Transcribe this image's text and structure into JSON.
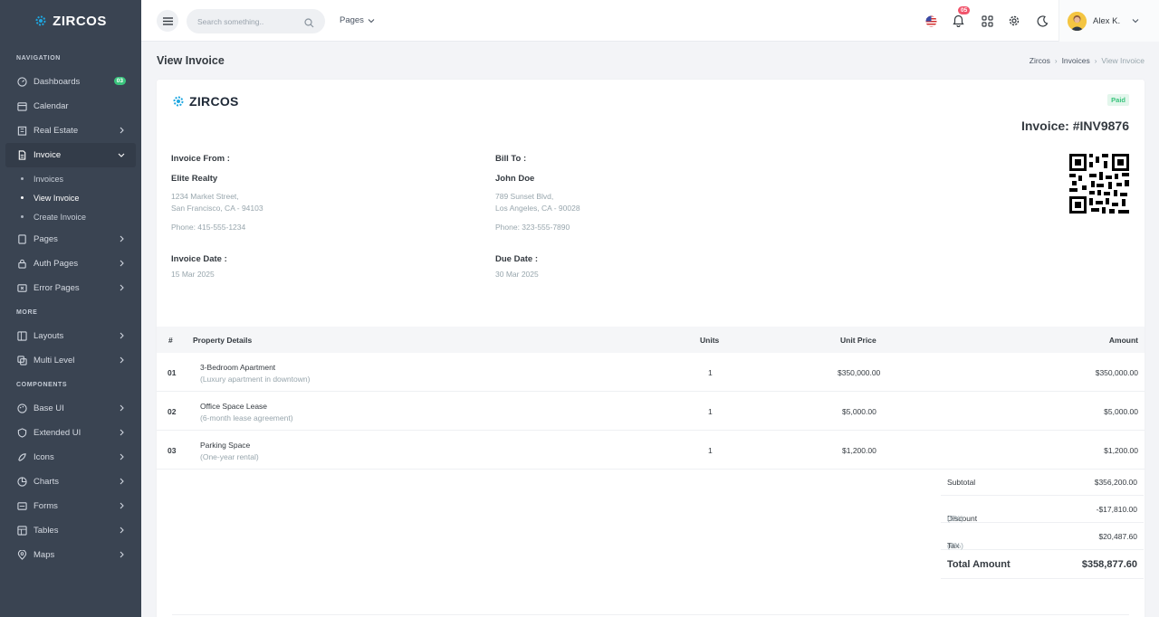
{
  "brand": {
    "name": "ZIRCOS"
  },
  "sidebar": {
    "sections": {
      "navigation": "NAVIGATION",
      "more": "MORE",
      "components": "COMPONENTS"
    },
    "items": {
      "dashboards": "Dashboards",
      "dashboards_badge": "03",
      "calendar": "Calendar",
      "real_estate": "Real Estate",
      "invoice": "Invoice",
      "invoices": "Invoices",
      "view_invoice": "View Invoice",
      "create_invoice": "Create Invoice",
      "pages": "Pages",
      "auth_pages": "Auth Pages",
      "error_pages": "Error Pages",
      "layouts": "Layouts",
      "multi_level": "Multi Level",
      "base_ui": "Base UI",
      "extended_ui": "Extended UI",
      "icons": "Icons",
      "charts": "Charts",
      "forms": "Forms",
      "tables": "Tables",
      "maps": "Maps"
    }
  },
  "topbar": {
    "search_placeholder": "Search something..",
    "pages_label": "Pages",
    "notification_count": "05",
    "user_name": "Alex K."
  },
  "page": {
    "title": "View Invoice",
    "breadcrumb": [
      "Zircos",
      "Invoices",
      "View Invoice"
    ]
  },
  "invoice": {
    "status": "Paid",
    "number": "Invoice: #INV9876",
    "from_label": "Invoice From :",
    "from_name": "Elite Realty",
    "from_address1": "1234 Market Street,",
    "from_address2": "San Francisco, CA - 94103",
    "from_phone": "Phone: 415-555-1234",
    "to_label": "Bill To :",
    "to_name": "John Doe",
    "to_address1": "789 Sunset Blvd,",
    "to_address2": "Los Angeles, CA - 90028",
    "to_phone": "Phone: 323-555-7890",
    "date_label": "Invoice Date :",
    "date_value": "15 Mar 2025",
    "due_label": "Due Date :",
    "due_value": "30 Mar 2025"
  },
  "table": {
    "headers": {
      "num": "#",
      "details": "Property Details",
      "units": "Units",
      "price": "Unit Price",
      "amount": "Amount"
    },
    "rows": [
      {
        "num": "01",
        "title": "3-Bedroom Apartment",
        "sub": "(Luxury apartment in downtown)",
        "units": "1",
        "price": "$350,000.00",
        "amount": "$350,000.00"
      },
      {
        "num": "02",
        "title": "Office Space Lease",
        "sub": "(6-month lease agreement)",
        "units": "1",
        "price": "$5,000.00",
        "amount": "$5,000.00"
      },
      {
        "num": "03",
        "title": "Parking Space",
        "sub": "(One-year rental)",
        "units": "1",
        "price": "$1,200.00",
        "amount": "$1,200.00"
      }
    ]
  },
  "summary": {
    "subtotal_label": "Subtotal",
    "subtotal_value": "$356,200.00",
    "discount_label": "Discount",
    "discount_pct": "(5%)",
    "discount_value": "-$17,810.00",
    "tax_label": "Tax",
    "tax_pct": "(6%)",
    "tax_value": "$20,487.60",
    "total_label": "Total Amount",
    "total_value": "$358,877.60"
  },
  "colors": {
    "accent": "#0ea5d8",
    "sidebar": "#3a4452",
    "success": "#3ac47d",
    "danger": "#f1556c"
  }
}
